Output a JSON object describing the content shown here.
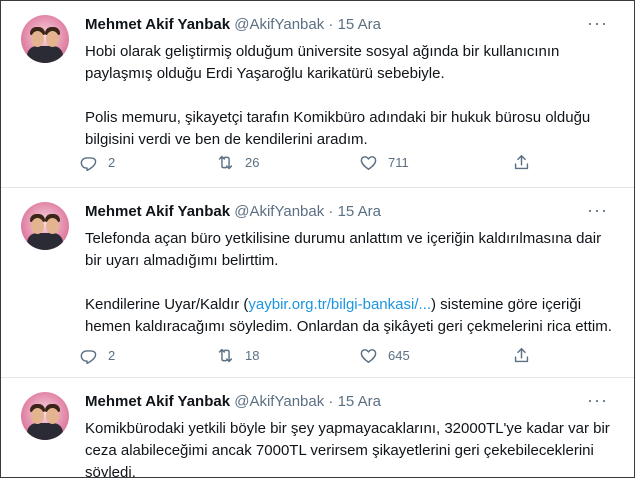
{
  "tweets": [
    {
      "name": "Mehmet Akif Yanbak",
      "handle": "@AkifYanbak",
      "separator": "·",
      "date": "15 Ara",
      "paragraphs": [
        "Hobi olarak geliştirmiş olduğum üniversite sosyal ağında bir kullanıcının paylaşmış olduğu Erdi Yaşaroğlu karikatürü sebebiyle.",
        "Polis memuru, şikayetçi tarafın Komikbüro adındaki bir hukuk bürosu olduğu bilgisini verdi ve ben de kendilerini aradım."
      ],
      "replies": "2",
      "retweets": "26",
      "likes": "711"
    },
    {
      "name": "Mehmet Akif Yanbak",
      "handle": "@AkifYanbak",
      "separator": "·",
      "date": "15 Ara",
      "p1": "Telefonda açan büro yetkilisine durumu anlattım ve içeriğin kaldırılmasına dair bir uyarı almadığımı belirttim.",
      "p2_before": "Kendilerine Uyar/Kaldır (",
      "p2_link": "yaybir.org.tr/bilgi-bankasi/...",
      "p2_after": ") sistemine göre içeriği hemen kaldıracağımı söyledim. Onlardan da şikâyeti geri çekmelerini rica ettim.",
      "replies": "2",
      "retweets": "18",
      "likes": "645"
    },
    {
      "name": "Mehmet Akif Yanbak",
      "handle": "@AkifYanbak",
      "separator": "·",
      "date": "15 Ara",
      "paragraphs": [
        "Komikbürodaki yetkili böyle bir şey yapmayacaklarını, 32000TL'ye kadar var bir ceza alabileceğimi ancak 7000TL verirsem şikayetlerini geri çekebileceklerini söyledi."
      ]
    }
  ],
  "icons": {
    "more": "more-dots-icon",
    "reply": "reply-icon",
    "retweet": "retweet-icon",
    "like": "heart-icon",
    "share": "share-icon"
  },
  "more_glyph": "···",
  "colors": {
    "link": "#1b95e0",
    "muted": "#5b7083",
    "avatar_bg": "#e79bb6"
  }
}
